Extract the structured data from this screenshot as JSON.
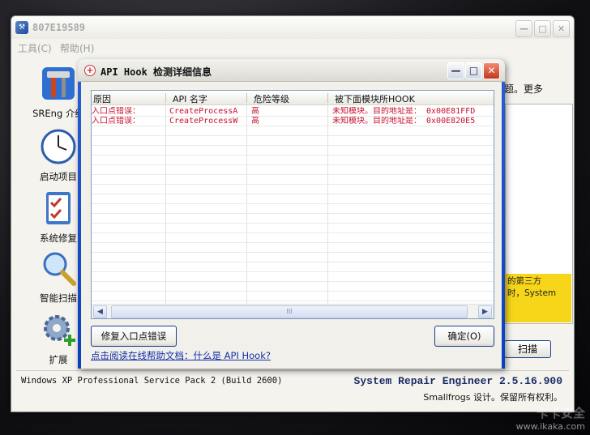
{
  "main_window": {
    "title": "807E19589",
    "menu": [
      "工具(C)",
      "帮助(H)"
    ],
    "sidebar": [
      {
        "label": "SREng 介绍",
        "icon": "tools-icon"
      },
      {
        "label": "启动项目",
        "icon": "clock-icon"
      },
      {
        "label": "系统修复",
        "icon": "checklist-icon"
      },
      {
        "label": "智能扫描",
        "icon": "magnifier-icon"
      },
      {
        "label": "扩展",
        "icon": "gear-plus-icon"
      }
    ],
    "tip_text": "题。更多",
    "yellow_note": [
      "的第三方",
      "时，System"
    ],
    "scan_button": "扫描",
    "status": "Windows XP Professional Service Pack 2 (Build 2600)",
    "brand": "System Repair Engineer 2.5.16.900",
    "copyright": "Smallfrogs 设计。保留所有权利。"
  },
  "dialog": {
    "title": "API Hook 检测详细信息",
    "columns": [
      "原因",
      "API 名字",
      "危险等级",
      "被下面模块所HOOK"
    ],
    "rows": [
      [
        "入口点错误：",
        "CreateProcessA",
        "高",
        "未知模块。目的地址是： 0x00E81FFD"
      ],
      [
        "入口点错误：",
        "CreateProcessW",
        "高",
        "未知模块。目的地址是： 0x00E820E5"
      ]
    ],
    "scroll_grip": "III",
    "fix_button": "修复入口点错误",
    "ok_button": "确定(O)",
    "help_link": "点击阅读在线帮助文档：什么是 API Hook?"
  },
  "watermark": {
    "line1": "卡卡安全",
    "line2": "www.ikaka.com"
  },
  "colors": {
    "title_blue": "#0a3fbd",
    "error_red": "#c8102e",
    "brand_navy": "#1a2b66",
    "note_yellow": "#f7d61a"
  }
}
